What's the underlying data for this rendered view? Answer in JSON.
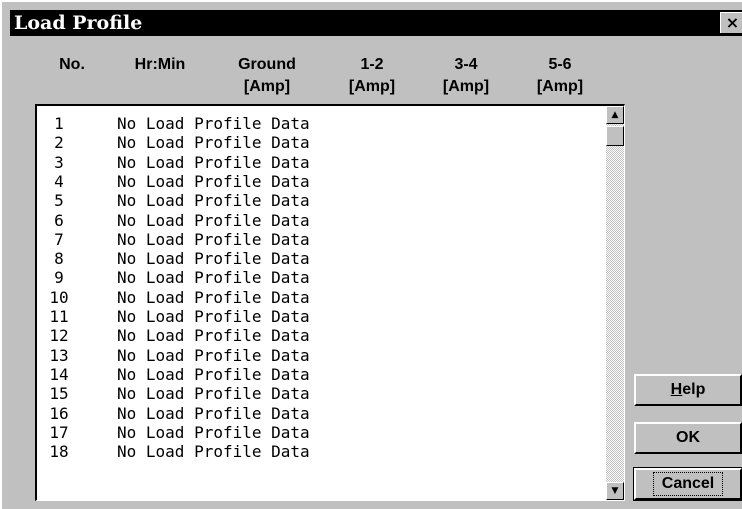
{
  "window": {
    "title": "Load Profile",
    "close_label": "×"
  },
  "columns": [
    {
      "line1": "No.",
      "line2": ""
    },
    {
      "line1": "Hr:Min",
      "line2": ""
    },
    {
      "line1": "Ground",
      "line2": "[Amp]"
    },
    {
      "line1": "1-2",
      "line2": "[Amp]"
    },
    {
      "line1": "3-4",
      "line2": "[Amp]"
    },
    {
      "line1": "5-6",
      "line2": "[Amp]"
    }
  ],
  "rows": [
    {
      "no": "1",
      "text": "No Load Profile Data"
    },
    {
      "no": "2",
      "text": "No Load Profile Data"
    },
    {
      "no": "3",
      "text": "No Load Profile Data"
    },
    {
      "no": "4",
      "text": "No Load Profile Data"
    },
    {
      "no": "5",
      "text": "No Load Profile Data"
    },
    {
      "no": "6",
      "text": "No Load Profile Data"
    },
    {
      "no": "7",
      "text": "No Load Profile Data"
    },
    {
      "no": "8",
      "text": "No Load Profile Data"
    },
    {
      "no": "9",
      "text": "No Load Profile Data"
    },
    {
      "no": "10",
      "text": "No Load Profile Data"
    },
    {
      "no": "11",
      "text": "No Load Profile Data"
    },
    {
      "no": "12",
      "text": "No Load Profile Data"
    },
    {
      "no": "13",
      "text": "No Load Profile Data"
    },
    {
      "no": "14",
      "text": "No Load Profile Data"
    },
    {
      "no": "15",
      "text": "No Load Profile Data"
    },
    {
      "no": "16",
      "text": "No Load Profile Data"
    },
    {
      "no": "17",
      "text": "No Load Profile Data"
    },
    {
      "no": "18",
      "text": "No Load Profile Data"
    }
  ],
  "scrollbar": {
    "up_icon": "arrow-up-icon",
    "down_icon": "arrow-down-icon"
  },
  "buttons": {
    "help_mnemonic": "H",
    "help_rest": "elp",
    "ok": "OK",
    "cancel": "Cancel"
  }
}
